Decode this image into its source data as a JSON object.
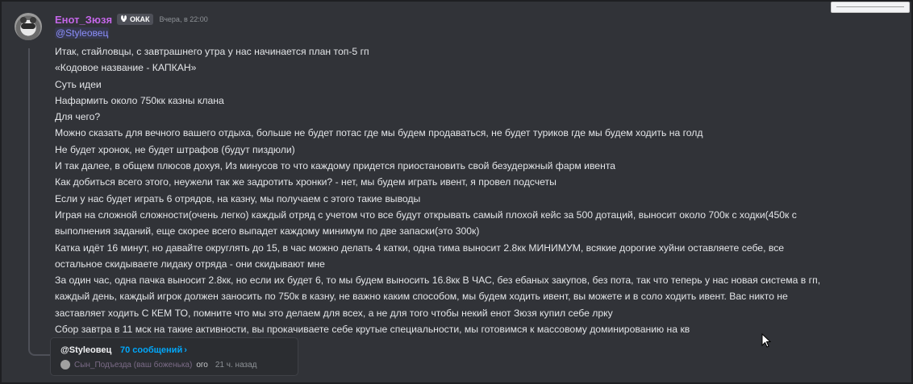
{
  "message": {
    "username": "Енот_Зюзя",
    "tag": {
      "icon": "bunny-ears-icon",
      "label": "ОКАК"
    },
    "timestamp": "Вчера, в 22:00",
    "mention": "@Styleовец",
    "lines": [
      "Итак, стайловцы, с завтрашнего утра у нас начинается план топ-5 гп",
      "«Кодовое название - КАПКАН»",
      "Суть идеи",
      "Нафармить около 750кк казны клана",
      "Для чего?",
      "Можно сказать для вечного вашего отдыха, больше не будет потас где мы будем продаваться, не будет туриков где мы будем ходить на голд",
      "Не будет хронок, не будет штрафов (будут пиздюли)",
      "И так далее, в общем плюсов дохуя, Из минусов то что каждому придется приостановить свой безудержный фарм ивента",
      "Как добиться всего этого, неужели так же задротить хронки? - нет, мы будем играть ивент, я провел подсчеты",
      "Если у нас будет играть 6 отрядов, на казну, мы получаем с этого такие выводы",
      "Играя на сложной сложности(очень легко) каждый отряд с учетом что все будут открывать самый плохой кейс за 500 дотаций, выносит около 700к с ходки(450к с",
      "выполнения заданий, еще скорее всего выпадет каждому минимум по две запаски(это 300к)",
      "Катка идёт 16 минут, но давайте округлять до 15, в час можно делать 4 катки, одна тима выносит 2.8кк МИНИМУМ, всякие дорогие хуйни оставляете себе, все",
      "остальное скидываете лидаку отряда - они скидывают мне",
      "За один час, одна пачка выносит 2.8кк, но если их будет 6, то мы будем выносить 16.8кк В ЧАС, без ебаных закупов, без пота, так что теперь у нас новая система в гп,",
      "каждый день, каждый игрок должен заносить по 750к в казну, не важно каким способом, мы будем ходить ивент, вы можете и в соло ходить ивент. Вас никто не",
      "заставляет ходить С КЕМ ТО, помните что мы это делаем для всех, а не для того чтобы некий енот Зюзя купил себе лрку",
      "Сбор завтра в 11 мск на такие активности, вы прокачиваете себе крутые специальности, мы готовимся к массовому доминированию на кв"
    ]
  },
  "thread": {
    "name": "@Styleовец",
    "count": "70 сообщений",
    "count_chevron": "›",
    "last_user": "Сын_Подъезда (ваш боженька)",
    "last_message": "ого",
    "last_time": "21 ч. назад"
  },
  "colors": {
    "background": "#313338",
    "username": "#c466e8",
    "mention": "#8c8ffa",
    "thread_count": "#00a8fc"
  }
}
